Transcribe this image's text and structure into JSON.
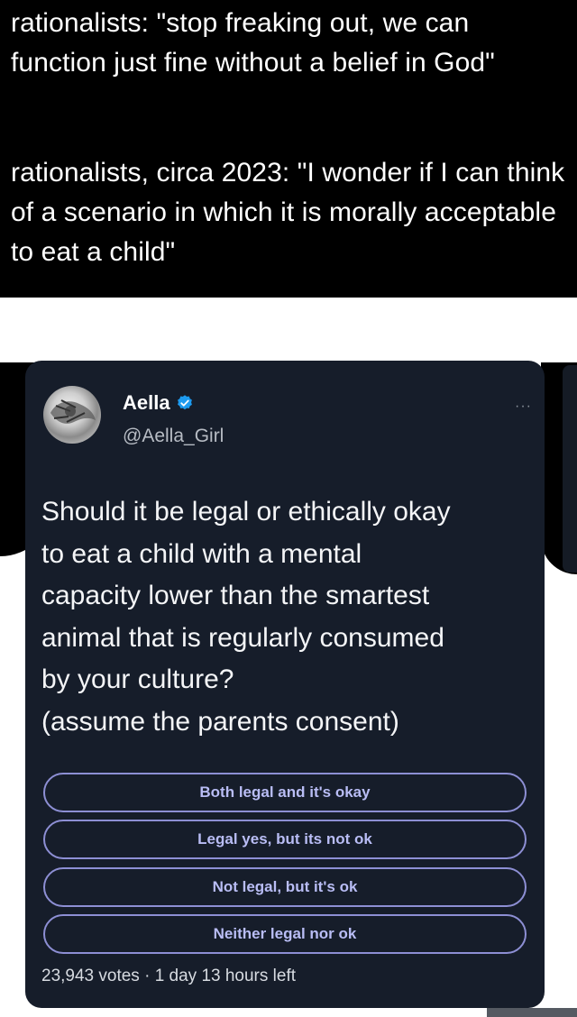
{
  "caption": {
    "line1": "rationalists: \"stop freaking out, we can function just fine without a belief in God\"",
    "line2": "rationalists, circa 2023: \"I wonder if I can think of a scenario in which it is morally acceptable to eat a child\""
  },
  "tweet": {
    "author_name": "Aella",
    "author_handle": "@Aella_Girl",
    "more_label": "···",
    "text_lines": [
      "Should it be legal or ethically okay",
      "to eat a child with a mental",
      "capacity lower than the smartest",
      "animal that is regularly consumed",
      "by your culture?",
      "(assume the parents consent)"
    ],
    "poll": {
      "options": [
        "Both legal and it's okay",
        "Legal yes, but its not ok",
        "Not legal, but it's ok",
        "Neither legal nor ok"
      ],
      "footer": "23,943 votes · 1 day 13 hours left"
    }
  },
  "colors": {
    "card_bg": "#161d2a",
    "poll_border": "#8d8fd4",
    "verified": "#1d9bf0"
  },
  "icons": {
    "verified": "verified-badge-icon",
    "more": "more-options-icon"
  }
}
